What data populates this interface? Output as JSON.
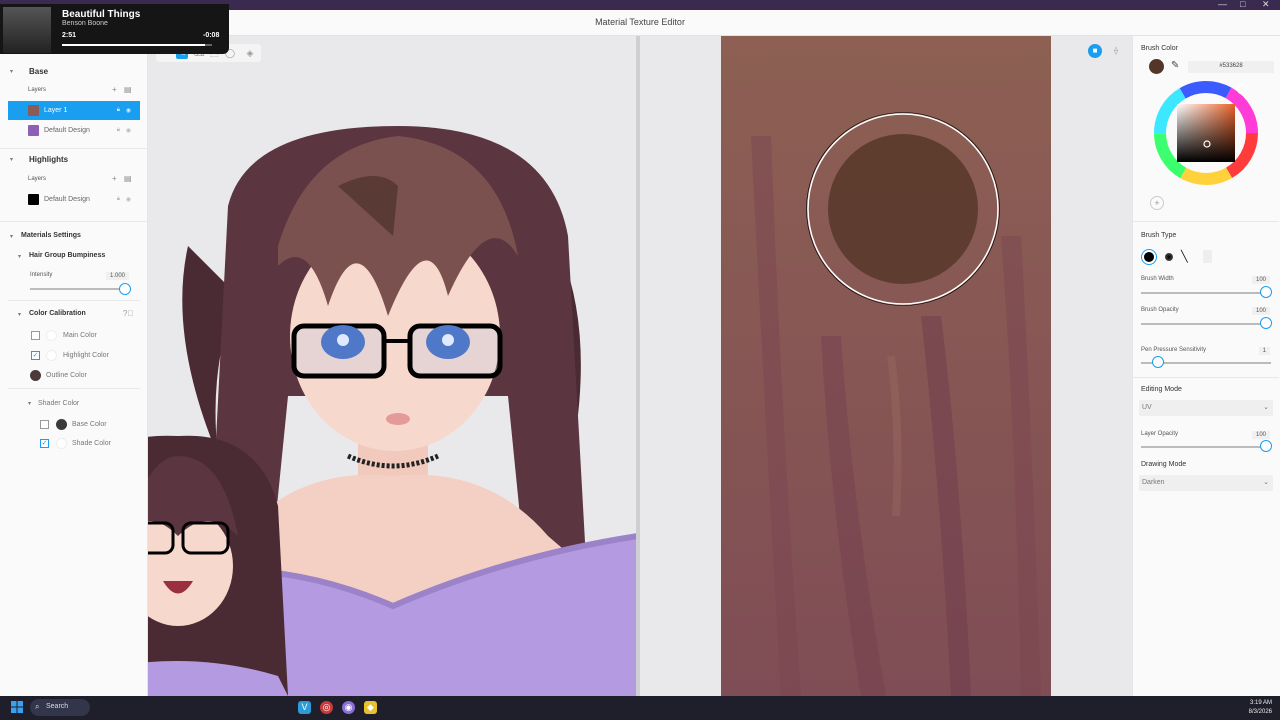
{
  "app": {
    "title": "Material Texture Editor"
  },
  "media": {
    "song": "Beautiful Things",
    "artist": "Benson Boone",
    "elapsed": "2:51",
    "remaining": "-0:08",
    "progress": 0.95
  },
  "left_panel": {
    "base": {
      "title": "Base",
      "layers_label": "Layers",
      "layers": [
        {
          "name": "Layer 1",
          "color": "#8b5c57",
          "selected": true
        },
        {
          "name": "Default Design",
          "color": "#8e5fb5",
          "selected": false
        }
      ]
    },
    "highlights": {
      "title": "Highlights",
      "layers_label": "Layers",
      "layers": [
        {
          "name": "Default Design",
          "color": "#000000",
          "selected": false
        }
      ]
    },
    "materials_settings": {
      "title": "Materials Settings",
      "hair_bumpiness": {
        "title": "Hair Group Bumpiness",
        "intensity_label": "Intensity",
        "intensity_value": "1.000",
        "level": 1.0
      },
      "color_calibration": {
        "title": "Color Calibration",
        "items": [
          {
            "label": "Main Color",
            "checked": false,
            "color": "#ffffff"
          },
          {
            "label": "Highlight Color",
            "checked": true,
            "color": "#ffffff"
          },
          {
            "label": "Outline Color",
            "checked": null,
            "color": "#4a3a3a"
          }
        ],
        "shader": {
          "title": "Shader Color",
          "items": [
            {
              "label": "Base Color",
              "checked": false,
              "color": "#3a3a3a"
            },
            {
              "label": "Shade Color",
              "checked": true,
              "color": "#ffffff"
            }
          ]
        }
      }
    }
  },
  "right_panel": {
    "brush_color": {
      "title": "Brush Color",
      "hex": "#533628",
      "swatch": "#533628"
    },
    "brush_type": {
      "title": "Brush Type"
    },
    "brush_width": {
      "label": "Brush Width",
      "value": "100",
      "level": 1.0
    },
    "brush_opacity": {
      "label": "Brush Opacity",
      "value": "100",
      "level": 1.0
    },
    "pen_pressure": {
      "label": "Pen Pressure Sensitivity",
      "value": "1",
      "level": 0.14
    },
    "editing_mode": {
      "title": "Editing Mode",
      "value": "UV"
    },
    "layer_opacity": {
      "label": "Layer Opacity",
      "value": "100",
      "level": 1.0
    },
    "drawing_mode": {
      "title": "Drawing Mode",
      "value": "Darken"
    }
  },
  "taskbar": {
    "search": "Search",
    "time": "3:19 AM",
    "date": "8/3/2026"
  },
  "colors": {
    "accent": "#1a9ef0",
    "texture_base": "#8b5c57",
    "brush_circle": "#5c3b2d",
    "header_purple": "#3b2a4f"
  }
}
